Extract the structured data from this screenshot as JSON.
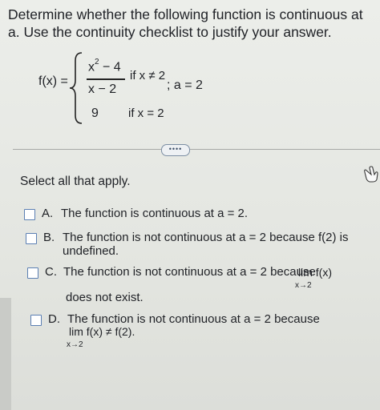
{
  "question": "Determine whether the following function is continuous at a. Use the continuity checklist to justify your answer.",
  "function": {
    "lhs": "f(x) =",
    "numerator_base": "x",
    "numerator_exp": "2",
    "numerator_rest": " − 4",
    "denominator": "x − 2",
    "condition1": "if x ≠ 2",
    "value2": "9",
    "condition2": "if x = 2",
    "a_value": "; a = 2"
  },
  "more_button": "••••",
  "instruction": "Select all that apply.",
  "options": [
    {
      "letter": "A.",
      "text": "The function is continuous at a = 2."
    },
    {
      "letter": "B.",
      "text_line1": "The function is not continuous at a = 2 because f(2) is",
      "text_line2": "undefined."
    },
    {
      "letter": "C.",
      "text_line1": "The function is not continuous at a = 2 because",
      "lim": "lim f(x)",
      "lim_sub": "x→2",
      "text_line2": "does not exist."
    },
    {
      "letter": "D.",
      "text_line1": "The function is not continuous at a = 2 because",
      "lim": "lim f(x) ≠ f(2).",
      "lim_sub": "x→2"
    }
  ],
  "colors": {
    "checkbox_border": "#5b7fb3",
    "button_border": "#7c8ea3"
  }
}
